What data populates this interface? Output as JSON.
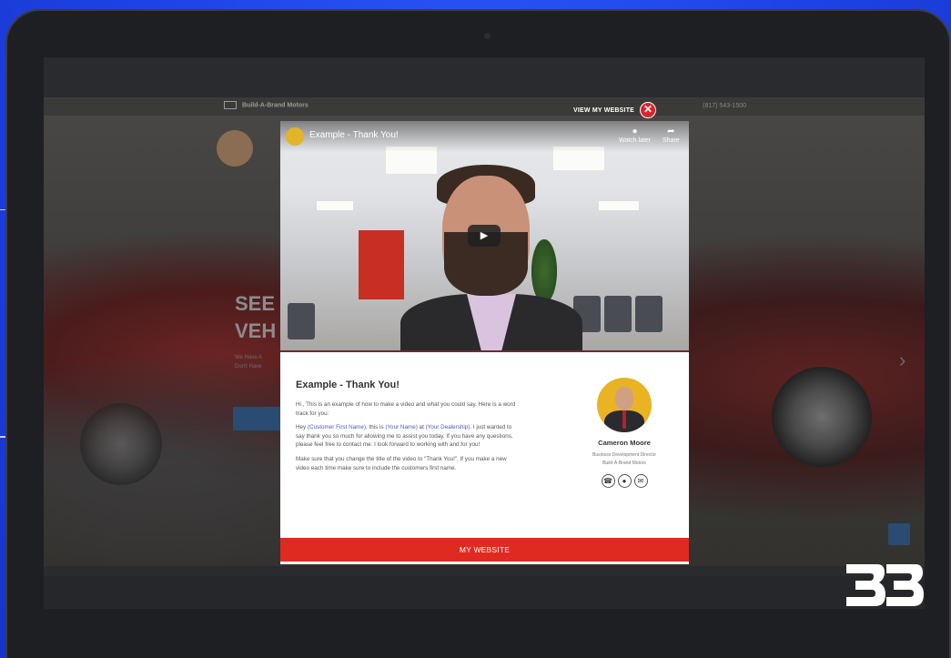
{
  "site": {
    "logo_text": "Build-A-Brand Motors",
    "nav_right": "(817) 543-1500",
    "hero_line1": "SEE",
    "hero_line2": "VEH",
    "hero_sub1": "We Have A",
    "hero_sub2": "Don't Have"
  },
  "modal": {
    "view_website_label": "VIEW MY WEBSITE",
    "close_label": "✕",
    "video": {
      "title": "Example - Thank You!",
      "watch_later_label": "Watch later",
      "share_label": "Share",
      "play_symbol": "▶"
    },
    "content": {
      "title": "Example - Thank You!",
      "para1": "Hi , This is an example of how to make a video and what you could say. Here is a word track for you:",
      "para2_prefix": "Hey ",
      "para2_customer": "(Customer First Name)",
      "para2_mid1": ", this is ",
      "para2_name": "(Your Name)",
      "para2_mid2": " at ",
      "para2_dealer": "(Your Dealership)",
      "para2_suffix": ". I just wanted to say thank you so much for allowing me to assist you today. If you have any questions, please feel free to contact me. I look forward to working with and for you!",
      "para3": "Make sure that you change the title of the video to \"Thank You!\". If you make a new video each time make sure to include the customers first name."
    },
    "card": {
      "name": "Cameron Moore",
      "role": "Business Development Director",
      "company": "Build-A-Brand Motors",
      "icons": [
        "phone-icon",
        "chat-icon",
        "email-icon"
      ]
    },
    "footer_button_label": "MY WEBSITE"
  },
  "colors": {
    "background": "#1f45e8",
    "accent_red": "#df2a21",
    "link_blue": "#4a5cc4",
    "avatar_yellow": "#e8b424"
  }
}
